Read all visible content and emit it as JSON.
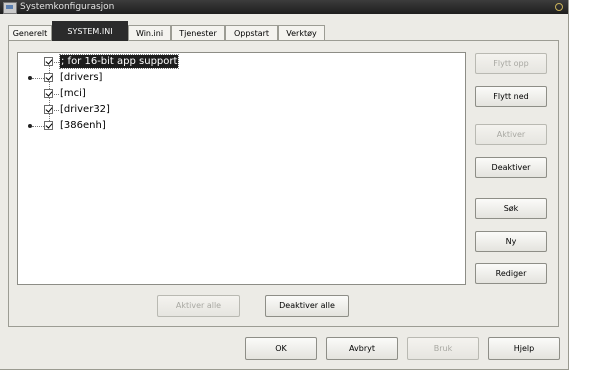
{
  "window": {
    "title": "Systemkonfigurasjon"
  },
  "tabs": [
    {
      "label": "Generelt",
      "active": false
    },
    {
      "label": "SYSTEM.INI",
      "active": true
    },
    {
      "label": "Win.ini",
      "active": false
    },
    {
      "label": "Tjenester",
      "active": false
    },
    {
      "label": "Oppstart",
      "active": false
    },
    {
      "label": "Verktøy",
      "active": false
    }
  ],
  "tree": [
    {
      "label": "; for 16-bit app support",
      "checked": true,
      "selected": true,
      "expandable": false
    },
    {
      "label": "[drivers]",
      "checked": true,
      "selected": false,
      "expandable": true
    },
    {
      "label": "[mci]",
      "checked": true,
      "selected": false,
      "expandable": false
    },
    {
      "label": "[driver32]",
      "checked": true,
      "selected": false,
      "expandable": false
    },
    {
      "label": "[386enh]",
      "checked": true,
      "selected": false,
      "expandable": true
    }
  ],
  "side_buttons": {
    "move_up": "Flytt opp",
    "move_down": "Flytt ned",
    "enable": "Aktiver",
    "disable": "Deaktiver",
    "search": "Søk",
    "new": "Ny",
    "edit": "Rediger"
  },
  "bottom_buttons": {
    "enable_all": "Aktiver alle",
    "disable_all": "Deaktiver alle"
  },
  "dialog_buttons": {
    "ok": "OK",
    "cancel": "Avbryt",
    "apply": "Bruk",
    "help": "Hjelp"
  }
}
